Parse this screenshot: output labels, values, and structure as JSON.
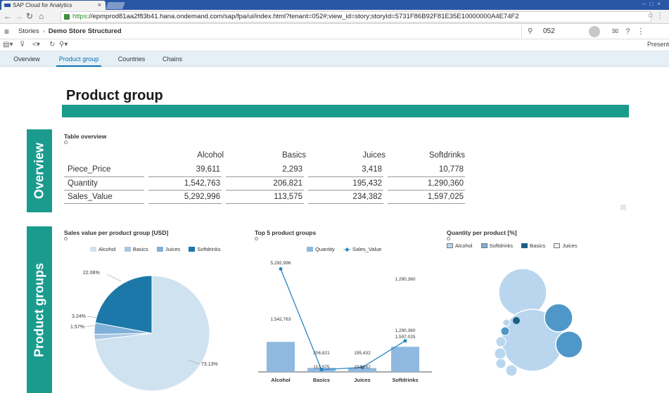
{
  "browser": {
    "tab_title": "SAP Cloud for Analytics",
    "tab_close": "×",
    "url_scheme": "https",
    "url_rest": "://epmprod81aa2f83b41.hana.ondemand.com/sap/fpa/ui/index.html?tenant=052#;view_id=story;storyId=5731F86B92F81E35E10000000A4E74F2"
  },
  "shell": {
    "breadcrumb_root": "Stories",
    "breadcrumb_current": "Demo Store Structured",
    "search_value": "052",
    "present_label": "Present"
  },
  "page_tabs": [
    "Overview",
    "Product group",
    "Countries",
    "Chains"
  ],
  "page": {
    "title": "Product group",
    "band_overview": "Overview",
    "band_groups": "Product groups"
  },
  "table": {
    "title": "Table overview",
    "columns": [
      "Alcohol",
      "Basics",
      "Juices",
      "Softdrinks"
    ],
    "rows": [
      {
        "label": "Piece_Price",
        "values": [
          "39,611",
          "2,293",
          "3,418",
          "10,778"
        ]
      },
      {
        "label": "Quantity",
        "values": [
          "1,542,763",
          "206,821",
          "195,432",
          "1,290,360"
        ]
      },
      {
        "label": "Sales_Value",
        "values": [
          "5,292,996",
          "113,575",
          "234,382",
          "1,597,025"
        ]
      }
    ]
  },
  "colors": {
    "teal": "#1a9b8e",
    "alcohol": "#cfe2f0",
    "basics": "#a9c8e3",
    "juices": "#7fb0d9",
    "softdrinks": "#1b78a9",
    "bar": "#8fb9df",
    "line": "#2a86c2"
  },
  "chart_data": [
    {
      "type": "pie",
      "title": "Sales value per product group [USD]",
      "categories": [
        "Alcohol",
        "Basics",
        "Juices",
        "Softdrinks"
      ],
      "values": [
        73.13,
        1.57,
        3.24,
        22.06
      ],
      "labels": [
        "73.13%",
        "1.57%",
        "3.24%",
        "22.06%"
      ]
    },
    {
      "type": "bar",
      "title": "Top 5 product groups",
      "categories": [
        "Alcohol",
        "Basics",
        "Juices",
        "Softdrinks"
      ],
      "series": [
        {
          "name": "Quantity",
          "values": [
            1542763,
            206821,
            195432,
            1290360
          ],
          "labels": [
            "1,542,763",
            "206,821",
            "195,432",
            "1,290,360"
          ]
        },
        {
          "name": "Sales_Value",
          "values": [
            5292996,
            113575,
            234382,
            1597025
          ],
          "labels": [
            "5,292,996",
            "113,575",
            "234,382",
            "1,597,025"
          ]
        }
      ],
      "ylim": [
        0,
        5600000
      ]
    },
    {
      "type": "scatter",
      "title": "Quantity per product [%]",
      "legend": [
        "Alcohol",
        "Softdrinks",
        "Basics",
        "Juices"
      ]
    }
  ]
}
